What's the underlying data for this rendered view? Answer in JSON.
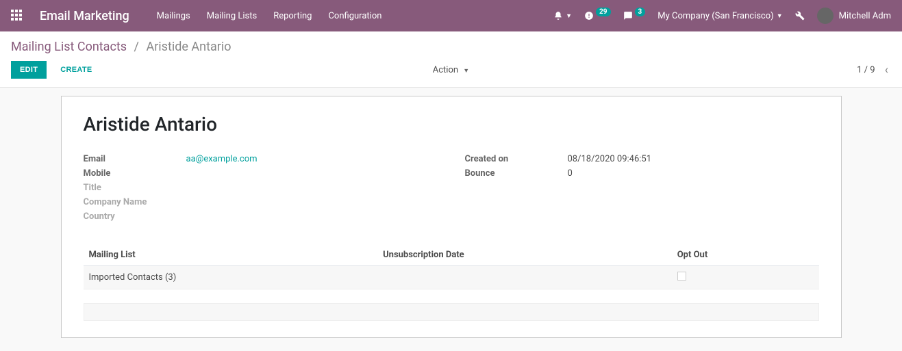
{
  "navbar": {
    "brand": "Email Marketing",
    "menu": [
      "Mailings",
      "Mailing Lists",
      "Reporting",
      "Configuration"
    ],
    "activity_badge": "29",
    "discuss_badge": "3",
    "company": "My Company (San Francisco)",
    "user": "Mitchell Adm"
  },
  "breadcrumb": {
    "parent": "Mailing List Contacts",
    "current": "Aristide Antario"
  },
  "buttons": {
    "edit": "Edit",
    "create": "Create",
    "action": "Action"
  },
  "pager": {
    "text": "1 / 9"
  },
  "record": {
    "title": "Aristide Antario",
    "labels": {
      "email": "Email",
      "mobile": "Mobile",
      "title": "Title",
      "company_name": "Company Name",
      "country": "Country",
      "created_on": "Created on",
      "bounce": "Bounce"
    },
    "email": "aa@example.com",
    "created_on": "08/18/2020 09:46:51",
    "bounce": "0"
  },
  "table": {
    "headers": {
      "mailing_list": "Mailing List",
      "unsub_date": "Unsubscription Date",
      "opt_out": "Opt Out"
    },
    "rows": [
      {
        "mailing_list": "Imported Contacts (3)",
        "unsub_date": "",
        "opt_out": false
      }
    ]
  }
}
